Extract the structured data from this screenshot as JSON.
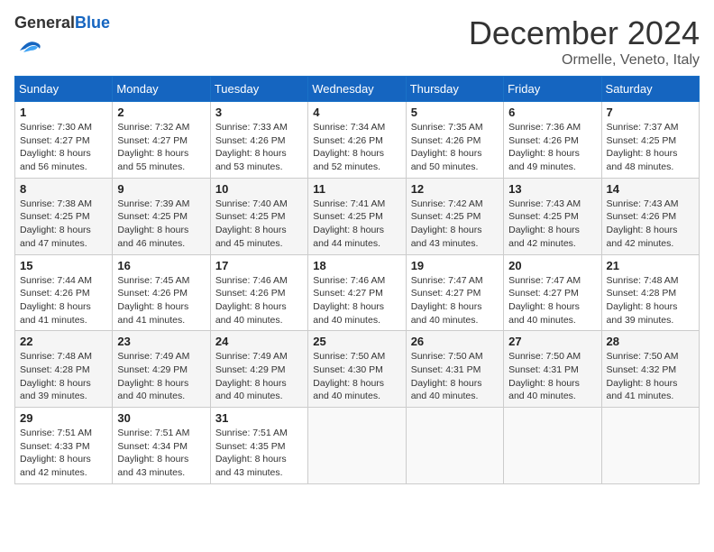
{
  "header": {
    "logo_general": "General",
    "logo_blue": "Blue",
    "month_title": "December 2024",
    "location": "Ormelle, Veneto, Italy"
  },
  "days_of_week": [
    "Sunday",
    "Monday",
    "Tuesday",
    "Wednesday",
    "Thursday",
    "Friday",
    "Saturday"
  ],
  "weeks": [
    [
      {
        "day": "1",
        "sunrise": "7:30 AM",
        "sunset": "4:27 PM",
        "daylight": "8 hours and 56 minutes."
      },
      {
        "day": "2",
        "sunrise": "7:32 AM",
        "sunset": "4:27 PM",
        "daylight": "8 hours and 55 minutes."
      },
      {
        "day": "3",
        "sunrise": "7:33 AM",
        "sunset": "4:26 PM",
        "daylight": "8 hours and 53 minutes."
      },
      {
        "day": "4",
        "sunrise": "7:34 AM",
        "sunset": "4:26 PM",
        "daylight": "8 hours and 52 minutes."
      },
      {
        "day": "5",
        "sunrise": "7:35 AM",
        "sunset": "4:26 PM",
        "daylight": "8 hours and 50 minutes."
      },
      {
        "day": "6",
        "sunrise": "7:36 AM",
        "sunset": "4:26 PM",
        "daylight": "8 hours and 49 minutes."
      },
      {
        "day": "7",
        "sunrise": "7:37 AM",
        "sunset": "4:25 PM",
        "daylight": "8 hours and 48 minutes."
      }
    ],
    [
      {
        "day": "8",
        "sunrise": "7:38 AM",
        "sunset": "4:25 PM",
        "daylight": "8 hours and 47 minutes."
      },
      {
        "day": "9",
        "sunrise": "7:39 AM",
        "sunset": "4:25 PM",
        "daylight": "8 hours and 46 minutes."
      },
      {
        "day": "10",
        "sunrise": "7:40 AM",
        "sunset": "4:25 PM",
        "daylight": "8 hours and 45 minutes."
      },
      {
        "day": "11",
        "sunrise": "7:41 AM",
        "sunset": "4:25 PM",
        "daylight": "8 hours and 44 minutes."
      },
      {
        "day": "12",
        "sunrise": "7:42 AM",
        "sunset": "4:25 PM",
        "daylight": "8 hours and 43 minutes."
      },
      {
        "day": "13",
        "sunrise": "7:43 AM",
        "sunset": "4:25 PM",
        "daylight": "8 hours and 42 minutes."
      },
      {
        "day": "14",
        "sunrise": "7:43 AM",
        "sunset": "4:26 PM",
        "daylight": "8 hours and 42 minutes."
      }
    ],
    [
      {
        "day": "15",
        "sunrise": "7:44 AM",
        "sunset": "4:26 PM",
        "daylight": "8 hours and 41 minutes."
      },
      {
        "day": "16",
        "sunrise": "7:45 AM",
        "sunset": "4:26 PM",
        "daylight": "8 hours and 41 minutes."
      },
      {
        "day": "17",
        "sunrise": "7:46 AM",
        "sunset": "4:26 PM",
        "daylight": "8 hours and 40 minutes."
      },
      {
        "day": "18",
        "sunrise": "7:46 AM",
        "sunset": "4:27 PM",
        "daylight": "8 hours and 40 minutes."
      },
      {
        "day": "19",
        "sunrise": "7:47 AM",
        "sunset": "4:27 PM",
        "daylight": "8 hours and 40 minutes."
      },
      {
        "day": "20",
        "sunrise": "7:47 AM",
        "sunset": "4:27 PM",
        "daylight": "8 hours and 40 minutes."
      },
      {
        "day": "21",
        "sunrise": "7:48 AM",
        "sunset": "4:28 PM",
        "daylight": "8 hours and 39 minutes."
      }
    ],
    [
      {
        "day": "22",
        "sunrise": "7:48 AM",
        "sunset": "4:28 PM",
        "daylight": "8 hours and 39 minutes."
      },
      {
        "day": "23",
        "sunrise": "7:49 AM",
        "sunset": "4:29 PM",
        "daylight": "8 hours and 40 minutes."
      },
      {
        "day": "24",
        "sunrise": "7:49 AM",
        "sunset": "4:29 PM",
        "daylight": "8 hours and 40 minutes."
      },
      {
        "day": "25",
        "sunrise": "7:50 AM",
        "sunset": "4:30 PM",
        "daylight": "8 hours and 40 minutes."
      },
      {
        "day": "26",
        "sunrise": "7:50 AM",
        "sunset": "4:31 PM",
        "daylight": "8 hours and 40 minutes."
      },
      {
        "day": "27",
        "sunrise": "7:50 AM",
        "sunset": "4:31 PM",
        "daylight": "8 hours and 40 minutes."
      },
      {
        "day": "28",
        "sunrise": "7:50 AM",
        "sunset": "4:32 PM",
        "daylight": "8 hours and 41 minutes."
      }
    ],
    [
      {
        "day": "29",
        "sunrise": "7:51 AM",
        "sunset": "4:33 PM",
        "daylight": "8 hours and 42 minutes."
      },
      {
        "day": "30",
        "sunrise": "7:51 AM",
        "sunset": "4:34 PM",
        "daylight": "8 hours and 43 minutes."
      },
      {
        "day": "31",
        "sunrise": "7:51 AM",
        "sunset": "4:35 PM",
        "daylight": "8 hours and 43 minutes."
      },
      null,
      null,
      null,
      null
    ]
  ],
  "labels": {
    "sunrise_label": "Sunrise:",
    "sunset_label": "Sunset:",
    "daylight_label": "Daylight:"
  }
}
